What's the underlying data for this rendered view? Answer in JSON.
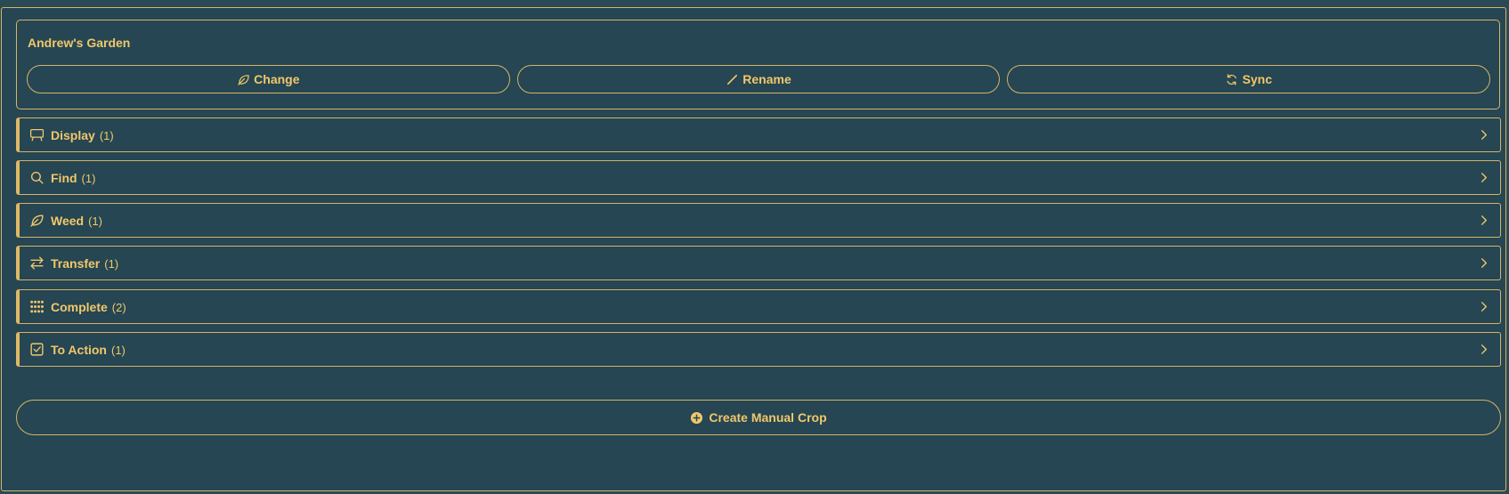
{
  "garden": {
    "title": "Andrew's Garden",
    "buttons": [
      {
        "label": "Change",
        "icon": "leaf-icon"
      },
      {
        "label": "Rename",
        "icon": "pencil-icon"
      },
      {
        "label": "Sync",
        "icon": "sync-icon"
      }
    ]
  },
  "sections": [
    {
      "label": "Display",
      "count": "(1)",
      "icon": "easel-icon"
    },
    {
      "label": "Find",
      "count": "(1)",
      "icon": "search-icon"
    },
    {
      "label": "Weed",
      "count": "(1)",
      "icon": "leaf-icon"
    },
    {
      "label": "Transfer",
      "count": "(1)",
      "icon": "transfer-arrows-icon"
    },
    {
      "label": "Complete",
      "count": "(2)",
      "icon": "grid-dots-icon"
    },
    {
      "label": "To Action",
      "count": "(1)",
      "icon": "checkbox-icon"
    }
  ],
  "create_button": {
    "label": "Create Manual Crop",
    "icon": "plus-circle-icon"
  },
  "colors": {
    "background": "#254652",
    "accent": "#f1c76b",
    "border": "#d8b36a"
  }
}
